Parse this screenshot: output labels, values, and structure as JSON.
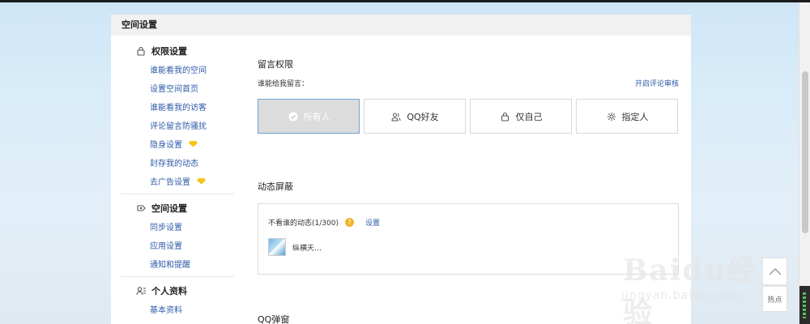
{
  "panel": {
    "title": "空间设置"
  },
  "nav": {
    "groups": [
      {
        "label": "权限设置",
        "icon": "lock-icon",
        "items": [
          {
            "label": "谁能看我的空间"
          },
          {
            "label": "设置空间首页"
          },
          {
            "label": "谁能看我的访客"
          },
          {
            "label": "评论留言防骚扰"
          },
          {
            "label": "隐身设置",
            "badge": "diamond-icon"
          },
          {
            "label": "封存我的动态"
          },
          {
            "label": "去广告设置",
            "badge": "diamond-icon"
          }
        ]
      },
      {
        "label": "空间设置",
        "icon": "space-settings-icon",
        "items": [
          {
            "label": "同步设置"
          },
          {
            "label": "应用设置"
          },
          {
            "label": "通知和提醒"
          }
        ]
      },
      {
        "label": "个人资料",
        "icon": "profile-icon",
        "items": [
          {
            "label": "基本资料"
          }
        ]
      }
    ]
  },
  "message_perm": {
    "title": "留言权限",
    "who_label": "谁能给我留言：",
    "review_link": "开启评论审核",
    "options": [
      {
        "label": "所有人",
        "icon": "check-circle-icon",
        "selected": true
      },
      {
        "label": "QQ好友",
        "icon": "friends-icon",
        "selected": false
      },
      {
        "label": "仅自己",
        "icon": "lock-icon",
        "selected": false
      },
      {
        "label": "指定人",
        "icon": "gear-icon",
        "selected": false
      }
    ]
  },
  "feed_block": {
    "title": "动态屏蔽",
    "line": "不看谁的动态(1/300)",
    "help_icon": "?",
    "settings_link": "设置",
    "friend_name": "纵横天…"
  },
  "next_section": {
    "title": "QQ弹窗"
  },
  "watermark": {
    "brand": "Baidu经验",
    "url": "jingyan.baidu.com"
  },
  "float": {
    "hot_label": "热点"
  },
  "colors": {
    "link": "#2e5aa8",
    "selected_border": "#6da2d6",
    "diamond": "#f6c51b"
  }
}
